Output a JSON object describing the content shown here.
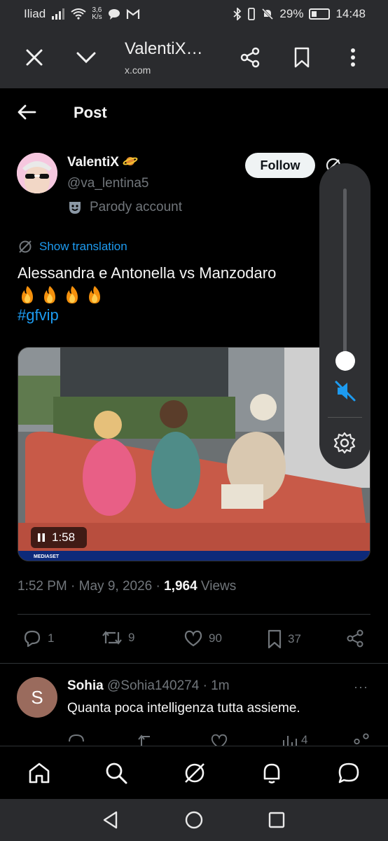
{
  "status_bar": {
    "carrier": "Iliad",
    "net_speed_value": "3,6",
    "net_speed_unit": "K/s",
    "battery": "29%",
    "battery_level": 0.29,
    "time": "14:48"
  },
  "browser": {
    "title": "ValentiX…",
    "url": "x.com"
  },
  "header": {
    "title": "Post"
  },
  "post": {
    "display_name": "ValentiX",
    "handle": "@va_lentina5",
    "parody_label": "Parody account",
    "follow_label": "Follow",
    "show_translation": "Show translation",
    "text": "Alessandra e Antonella vs Manzodaro",
    "hashtag": "#gfvip",
    "video_duration": "1:58",
    "video_brand": "MEDIASET",
    "time": "1:52 PM · May 9, 2026 · ",
    "views_count": "1,964",
    "views_label": " Views",
    "replies": "1",
    "reposts": "9",
    "likes": "90",
    "bookmarks": "37"
  },
  "volume_panel": {
    "level": 0.05,
    "muted": true
  },
  "reply": {
    "avatar_letter": "S",
    "name": "Sohia",
    "handle_time": " @Sohia140274 · 1m",
    "text": "Quanta poca intelligenza tutta assieme.",
    "reposts_partial": "",
    "views_partial": "4",
    "more": "···"
  },
  "colors": {
    "accent": "#1d9bf0",
    "muted_text": "#71767b",
    "mute_icon": "#1d9bf0"
  }
}
